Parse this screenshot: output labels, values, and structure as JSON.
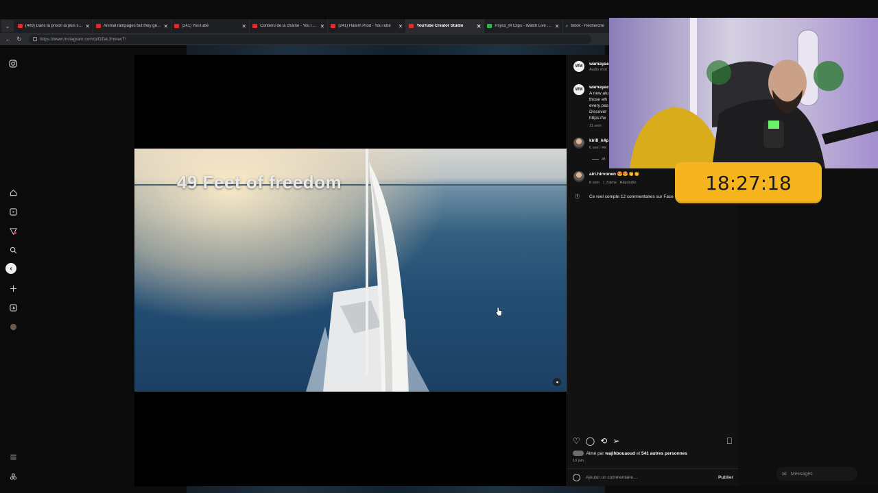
{
  "browser": {
    "tabs": [
      {
        "title": "(409) Dans la prison la plus surp",
        "icon": "youtube-icon",
        "active": false
      },
      {
        "title": "Animal rampages but they get w",
        "icon": "youtube-icon",
        "active": false
      },
      {
        "title": "(241) YouTube",
        "icon": "youtube-icon",
        "active": false
      },
      {
        "title": "Contenu de la chaîne - YouTube",
        "icon": "youtube-icon",
        "active": false
      },
      {
        "title": "(241) Hatem Prod - YouTube",
        "icon": "youtube-icon",
        "active": false
      },
      {
        "title": "YouTube Creator Studio",
        "icon": "youtube-icon",
        "active": true
      },
      {
        "title": "Psyco_M Clips - Watch Live on K",
        "icon": "kick-icon",
        "active": false
      },
      {
        "title": "tiktok - Recherche",
        "icon": "search-icon",
        "active": false
      }
    ],
    "url": "https://www.instagram.com/p/DZaL3nnIecT/"
  },
  "video": {
    "overlay_title": "49 Feet of freedom"
  },
  "panel": {
    "header_user": "wamayac",
    "header_sub": "Audio d'ori",
    "caption_user": "wamayac",
    "caption_lines": [
      "A new alu",
      "those wh",
      "every pas",
      "Discover",
      "https://w"
    ],
    "caption_time": "11 sem",
    "comments": [
      {
        "user": "kirill_k4p",
        "meta": "6 sem",
        "reply": "Ré",
        "extra": "Af"
      },
      {
        "user": "airi.hirvonen",
        "emojis": "😍😍👏👏",
        "meta_time": "8 sem",
        "meta_likes": "1 J'aime",
        "meta_reply": "Répondre"
      }
    ],
    "facebook_note": "Ce reel compte 12 commentaires sur Face",
    "liked_by_prefix": "Aimé par",
    "liked_by_user": "wajihbouaoud",
    "liked_by_mid": "et",
    "liked_by_rest": "541 autres personnes",
    "date": "10 juin",
    "comment_placeholder": "Ajouter un commentaire…",
    "publish_label": "Publier"
  },
  "overlay": {
    "timer": "18:27:18",
    "messages_label": "Messages"
  }
}
